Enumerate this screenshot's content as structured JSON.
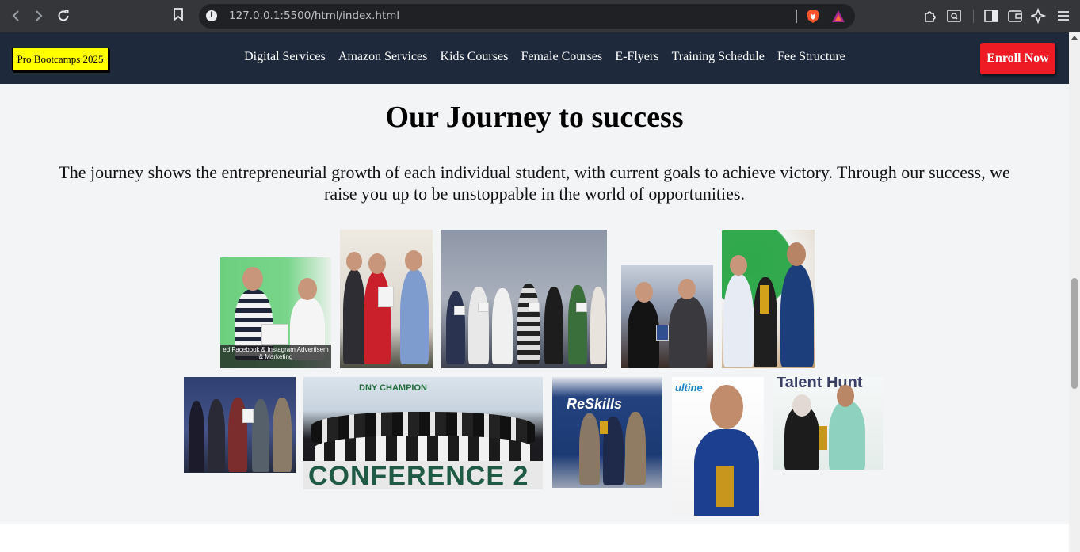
{
  "browser": {
    "url": "127.0.0.1:5500/html/index.html",
    "icons": [
      "back-icon",
      "forward-icon",
      "reload-icon",
      "bookmark-icon",
      "site-info-icon",
      "brave-shields-icon",
      "brave-rewards-icon",
      "extensions-icon",
      "page-search-icon",
      "sidebar-icon",
      "wallet-icon",
      "leo-ai-icon",
      "menu-icon"
    ]
  },
  "site": {
    "brand": "Pro Bootcamps 2025",
    "nav": [
      "Digital Services",
      "Amazon Services",
      "Kids Courses",
      "Female Courses",
      "E-Flyers",
      "Training Schedule",
      "Fee Structure"
    ],
    "cta": "Enroll Now",
    "colors": {
      "navbar": "#1e293b",
      "brand_bg": "#ffff00",
      "cta": "#ee1b24",
      "section_bg": "#f3f4f6"
    }
  },
  "journey": {
    "title": "Our Journey to success",
    "description": "The journey shows the entrepreneurial growth of each individual student, with current goals to achieve victory. Through our success, we raise you up to be unstoppable in the world of opportunities.",
    "photos": [
      {
        "name": "photo-facebook-instagram-certificate",
        "caption": "ed Facebook & Instagram Advertisem",
        "caption2": "& Marketing"
      },
      {
        "name": "photo-certificate-handover"
      },
      {
        "name": "photo-group-certificates"
      },
      {
        "name": "photo-shield-award"
      },
      {
        "name": "photo-trophy-president"
      },
      {
        "name": "photo-reskills-award"
      },
      {
        "name": "photo-conference-group",
        "banner": "CONFERENCE 2"
      },
      {
        "name": "photo-reskills-stage",
        "banner": "ReSkills"
      },
      {
        "name": "photo-trophy-portrait"
      },
      {
        "name": "photo-talent-award",
        "banner": "Talent Hunt"
      }
    ]
  }
}
